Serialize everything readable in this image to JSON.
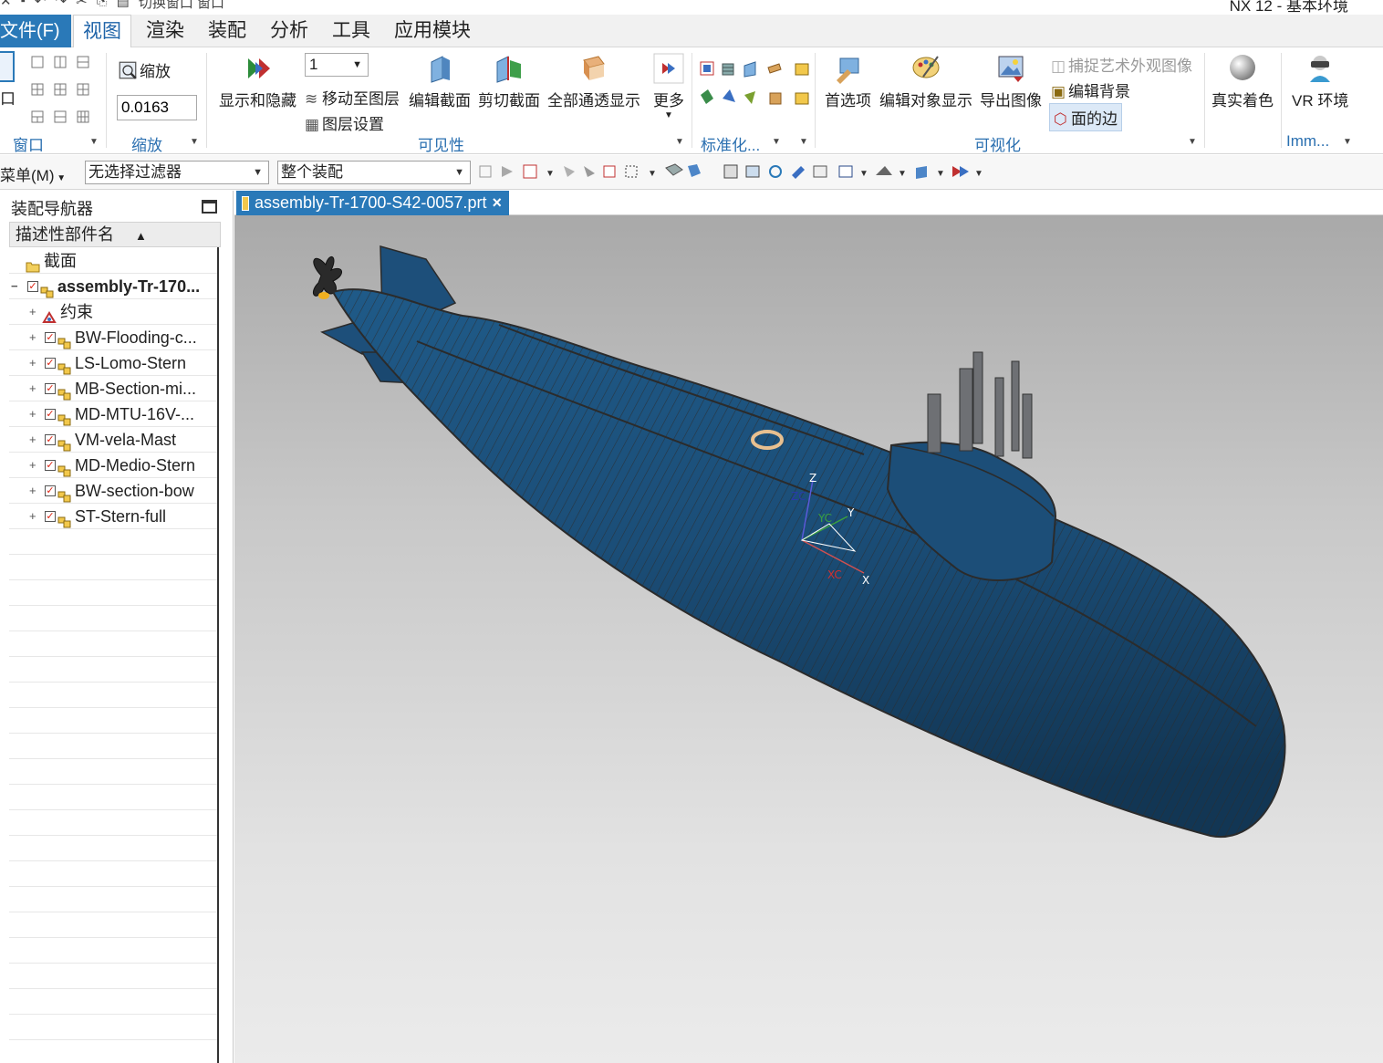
{
  "window": {
    "title": "NX 12 - 基本环境",
    "quick_access": "切换窗口  窗口"
  },
  "ribbon_tabs": [
    {
      "label": "文件(F)"
    },
    {
      "label": "视图"
    },
    {
      "label": "渲染"
    },
    {
      "label": "装配"
    },
    {
      "label": "分析"
    },
    {
      "label": "工具"
    },
    {
      "label": "应用模块"
    }
  ],
  "ribbon": {
    "window_group": {
      "label": "窗口",
      "partial_label": "口"
    },
    "zoom_group": {
      "label": "缩放",
      "zoom_button": "缩放",
      "zoom_value": "0.0163"
    },
    "visibility_group": {
      "label": "可见性",
      "layer_value": "1",
      "show_hide": "显示和隐藏",
      "move_to_layer": "移动至图层",
      "layer_settings": "图层设置",
      "edit_section": "编辑截面",
      "clip_section": "剪切截面",
      "all_translucent": "全部通透显示",
      "more": "更多"
    },
    "standard_group": {
      "label": "标准化..."
    },
    "visualization_group": {
      "label": "可视化",
      "preferences": "首选项",
      "edit_object_display": "编辑对象显示",
      "export_image": "导出图像",
      "capture_art": "捕捉艺术外观图像",
      "edit_background": "编辑背景",
      "face_edges": "面的边"
    },
    "true_shading": "真实着色",
    "vr_env": "VR 环境",
    "imm_group": {
      "label": "Imm..."
    }
  },
  "toolbar": {
    "menu": "菜单(M)",
    "filter": "无选择过滤器",
    "scope": "整个装配"
  },
  "navigator": {
    "title": "装配导航器",
    "column_header": "描述性部件名",
    "rows": [
      {
        "label": "截面"
      },
      {
        "label": "assembly-Tr-170..."
      },
      {
        "label": "约束"
      },
      {
        "label": "BW-Flooding-c..."
      },
      {
        "label": "LS-Lomo-Stern"
      },
      {
        "label": "MB-Section-mi..."
      },
      {
        "label": "MD-MTU-16V-..."
      },
      {
        "label": "VM-vela-Mast"
      },
      {
        "label": "MD-Medio-Stern"
      },
      {
        "label": "BW-section-bow"
      },
      {
        "label": "ST-Stern-full"
      }
    ]
  },
  "document": {
    "tab_label": "assembly-Tr-1700-S42-0057.prt",
    "close_glyph": "×"
  },
  "triad": {
    "z": "Z",
    "zc": "ZC",
    "yc": "YC",
    "y": "Y",
    "xc": "XC",
    "x": "X"
  },
  "colors": {
    "accent": "#2a79b8",
    "hull": "#1c4e78",
    "hull_dark": "#123654",
    "seam": "#2b2b2b",
    "mast": "#6e7074"
  }
}
